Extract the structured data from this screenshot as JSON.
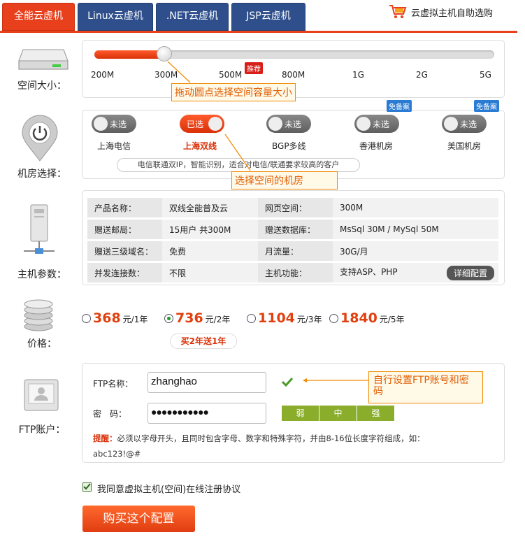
{
  "tabs": [
    "全能云虚机",
    "Linux云虚机",
    ".NET云虚机",
    "JSP云虚机"
  ],
  "shop_link": "云虚拟主机自助选购",
  "sections": {
    "space": "空间大小：",
    "room": "机房选择：",
    "params": "主机参数：",
    "price": "价格：",
    "ftp": "FTP账户："
  },
  "slider": {
    "ticks": [
      "200M",
      "300M",
      "500M",
      "800M",
      "1G",
      "2G",
      "5G"
    ],
    "recommend_badge": "推荐",
    "callout": "拖动圆点选择空间容量大小",
    "selected_fraction": 0.17
  },
  "rooms": {
    "items": [
      {
        "name": "上海电信",
        "state": "未选"
      },
      {
        "name": "上海双线",
        "state": "已选"
      },
      {
        "name": "BGP多线",
        "state": "未选"
      },
      {
        "name": "香港机房",
        "state": "未选",
        "badge": "免备案"
      },
      {
        "name": "美国机房",
        "state": "未选",
        "badge": "免备案"
      }
    ],
    "hint": "电信联通双IP，智能识别，适合对电信/联通要求较高的客户",
    "callout": "选择空间的机房"
  },
  "params": {
    "rows": [
      [
        "产品名称：",
        "双线全能普及云",
        "网页空间：",
        "300M"
      ],
      [
        "赠送邮局：",
        "15用户 共300M",
        "赠送数据库：",
        "MsSql 30M / MySql 50M"
      ],
      [
        "赠送三级域名：",
        "免费",
        "月流量：",
        "30G/月"
      ],
      [
        "并发连接数：",
        "不限",
        "主机功能：",
        "支持ASP、PHP"
      ]
    ],
    "detail_button": "详细配置"
  },
  "prices": [
    {
      "amount": "368",
      "unit": "元/1年",
      "selected": false
    },
    {
      "amount": "736",
      "unit": "元/2年",
      "selected": true
    },
    {
      "amount": "1104",
      "unit": "元/3年",
      "selected": false
    },
    {
      "amount": "1840",
      "unit": "元/5年",
      "selected": false
    }
  ],
  "promo": "买2年送1年",
  "ftp": {
    "name_label": "FTP名称：",
    "name_value": "zhanghao",
    "pwd_label": "密　码：",
    "pwd_value": "●●●●●●●●●●●",
    "strength": [
      "弱",
      "中",
      "强"
    ],
    "callout": "自行设置FTP账号和密码",
    "tip_label": "提醒：",
    "tip_text": "必须以字母开头，且同时包含字母、数字和特殊字符，并由8-16位长度字符组成，如：",
    "tip_example": "abc123!@#"
  },
  "agree": "我同意虚拟主机(空间)在线注册协议",
  "buy_button": "购买这个配置",
  "colors": {
    "accent": "#e8401c",
    "tab_blue": "#2e4f8c",
    "callout": "#f08a00"
  }
}
